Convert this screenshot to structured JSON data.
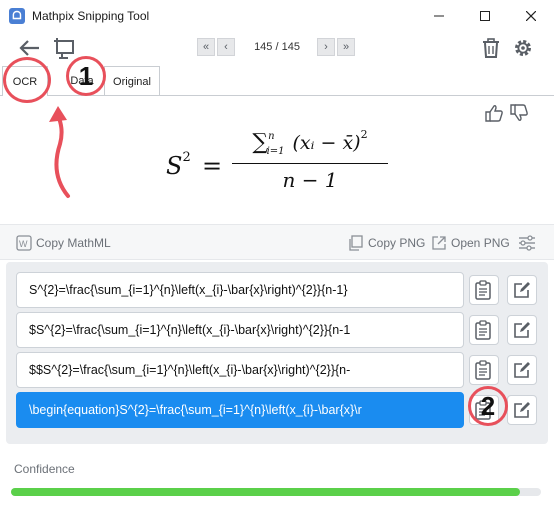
{
  "window": {
    "title": "Mathpix Snipping Tool"
  },
  "toolbar": {
    "page_counter": "145 / 145",
    "icons": [
      "back-arrow-icon",
      "screen-capture-icon",
      "first-page-icon",
      "prev-page-icon",
      "next-page-icon",
      "last-page-icon",
      "trash-icon",
      "gear-icon"
    ]
  },
  "tabs": [
    {
      "label": "OCR",
      "active": true
    },
    {
      "label": "Data"
    },
    {
      "label": "Original"
    }
  ],
  "preview": {
    "formula": {
      "lhs": "S",
      "lhs_exp": "2",
      "eq": "=",
      "sigma": "∑",
      "lim_sup": "n",
      "lim_sub": "i=1",
      "num_body": "(xᵢ − x̄)",
      "num_exp": "2",
      "den": "n − 1"
    }
  },
  "copy_bar": {
    "copy_mathml": "Copy MathML",
    "copy_png": "Copy PNG",
    "open_png": "Open PNG"
  },
  "results": [
    "S^{2}=\\frac{\\sum_{i=1}^{n}\\left(x_{i}-\\bar{x}\\right)^{2}}{n-1}",
    "$S^{2}=\\frac{\\sum_{i=1}^{n}\\left(x_{i}-\\bar{x}\\right)^{2}}{n-1",
    "$$S^{2}=\\frac{\\sum_{i=1}^{n}\\left(x_{i}-\\bar{x}\\right)^{2}}{n-",
    "\\begin{equation}S^{2}=\\frac{\\sum_{i=1}^{n}\\left(x_{i}-\\bar{x}\\r"
  ],
  "selected_result": 3,
  "confidence": {
    "label": "Confidence",
    "value": 0.96,
    "color": "#5bd04a"
  },
  "annotations": {
    "badge_1": "1",
    "badge_2": "2",
    "color": "#e8505b"
  },
  "colors": {
    "accent": "#1a8cf0",
    "logo": "#4a7fd4"
  }
}
